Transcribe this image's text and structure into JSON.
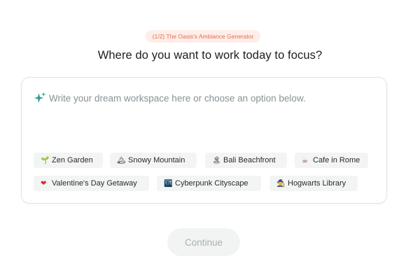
{
  "header": {
    "step_badge": "(1/2) The Oasis's Ambiance Generator",
    "question": "Where do you want to work today to focus?"
  },
  "prompt": {
    "placeholder": "Write your dream workspace here or choose an option below.",
    "value": "",
    "icon": "sparkle-icon",
    "icon_color": "#2a9d8f"
  },
  "options": [
    {
      "label": "Zen Garden",
      "icon": "leaf-icon",
      "glyph": "🌱"
    },
    {
      "label": "Snowy Mountain",
      "icon": "mountain-icon",
      "glyph": "🏔"
    },
    {
      "label": "Bali Beachfront",
      "icon": "island-icon",
      "glyph": "🏝"
    },
    {
      "label": "Cafe in Rome",
      "icon": "coffee-icon",
      "glyph": "☕"
    },
    {
      "label": "Valentine's Day Getaway",
      "icon": "heart-icon",
      "glyph": "❤"
    },
    {
      "label": "Cyberpunk Cityscape",
      "icon": "city-icon",
      "glyph": "🌃"
    },
    {
      "label": "Hogwarts Library",
      "icon": "wizard-icon",
      "glyph": "🧙"
    }
  ],
  "footer": {
    "continue_label": "Continue"
  },
  "colors": {
    "accent": "#e86c52",
    "badge_bg": "#fdeee9",
    "chip_bg": "#f3f4f4",
    "button_disabled_bg": "#f2f4f4",
    "button_disabled_text": "#a7b0b3"
  }
}
